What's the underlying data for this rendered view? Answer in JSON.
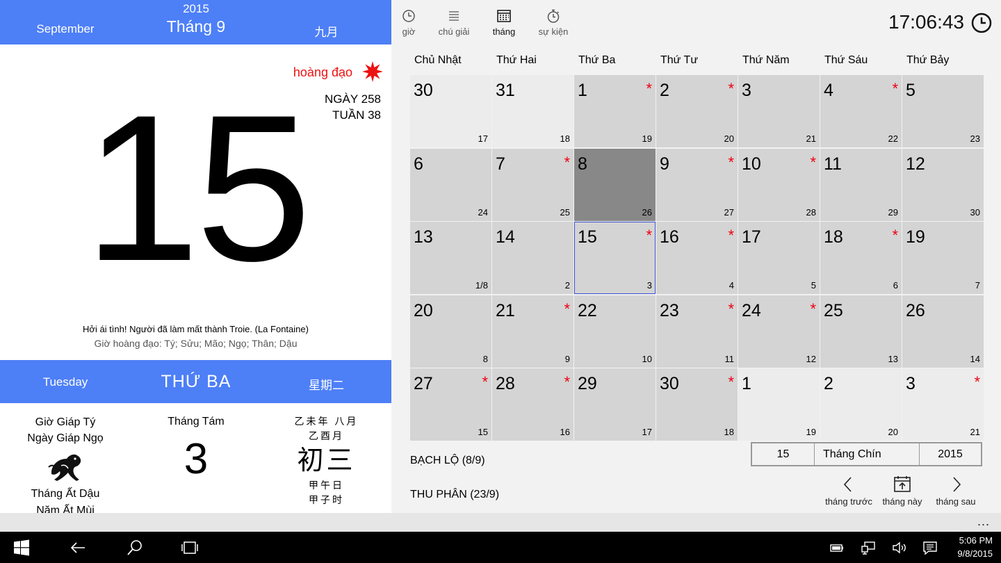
{
  "header": {
    "english_month": "September",
    "year": "2015",
    "vietnamese_month": "Tháng 9",
    "chinese_month": "九月"
  },
  "day_info": {
    "auspicious_label": "hoàng đạo",
    "day_of_year": "NGÀY 258",
    "week_of_year": "TUẦN 38",
    "day": "15",
    "quote": "Hởi ái tình! Người đã làm mất thành Troie. (La Fontaine)",
    "good_hours": "Giờ hoàng đạo: Tý; Sửu; Mão; Ngọ; Thân; Dậu"
  },
  "weekday": {
    "english": "Tuesday",
    "vietnamese": "THỨ BA",
    "chinese": "星期二"
  },
  "lunar": {
    "hour": "Giờ Giáp Tý",
    "day_name": "Ngày Giáp Ngọ",
    "month_name": "Tháng Ất Dậu",
    "year_name": "Năm Ất Mùi",
    "month_label": "Tháng Tám",
    "lunar_day": "3",
    "cn_line1": "乙未年 八月",
    "cn_line2": "乙酉月",
    "cn_big": "初三",
    "cn_line3": "甲午日",
    "cn_line4": "甲子时"
  },
  "toolbar": {
    "items": [
      {
        "label": "giờ",
        "icon": "clock-icon"
      },
      {
        "label": "chú giải",
        "icon": "list-icon"
      },
      {
        "label": "tháng",
        "icon": "calendar-icon"
      },
      {
        "label": "sự kiện",
        "icon": "stopwatch-icon"
      }
    ],
    "active": "tháng",
    "clock": "17:06:43"
  },
  "calendar": {
    "weekdays": [
      "Chủ Nhật",
      "Thứ Hai",
      "Thứ Ba",
      "Thứ Tư",
      "Thứ Năm",
      "Thứ Sáu",
      "Thứ Bảy"
    ],
    "weeks": [
      [
        {
          "d": "30",
          "l": "17",
          "other": true,
          "star": false
        },
        {
          "d": "31",
          "l": "18",
          "other": true,
          "star": false
        },
        {
          "d": "1",
          "l": "19",
          "star": true
        },
        {
          "d": "2",
          "l": "20",
          "star": true
        },
        {
          "d": "3",
          "l": "21",
          "star": false
        },
        {
          "d": "4",
          "l": "22",
          "star": true
        },
        {
          "d": "5",
          "l": "23",
          "star": false
        }
      ],
      [
        {
          "d": "6",
          "l": "24",
          "star": false
        },
        {
          "d": "7",
          "l": "25",
          "star": true
        },
        {
          "d": "8",
          "l": "26",
          "star": false,
          "today": true
        },
        {
          "d": "9",
          "l": "27",
          "star": true
        },
        {
          "d": "10",
          "l": "28",
          "star": true
        },
        {
          "d": "11",
          "l": "29",
          "star": false
        },
        {
          "d": "12",
          "l": "30",
          "star": false
        }
      ],
      [
        {
          "d": "13",
          "l": "1/8",
          "star": false
        },
        {
          "d": "14",
          "l": "2",
          "star": false
        },
        {
          "d": "15",
          "l": "3",
          "star": true,
          "selected": true
        },
        {
          "d": "16",
          "l": "4",
          "star": true
        },
        {
          "d": "17",
          "l": "5",
          "star": false
        },
        {
          "d": "18",
          "l": "6",
          "star": true
        },
        {
          "d": "19",
          "l": "7",
          "star": false
        }
      ],
      [
        {
          "d": "20",
          "l": "8",
          "star": false
        },
        {
          "d": "21",
          "l": "9",
          "star": true
        },
        {
          "d": "22",
          "l": "10",
          "star": false
        },
        {
          "d": "23",
          "l": "11",
          "star": true
        },
        {
          "d": "24",
          "l": "12",
          "star": true
        },
        {
          "d": "25",
          "l": "13",
          "star": false
        },
        {
          "d": "26",
          "l": "14",
          "star": false
        }
      ],
      [
        {
          "d": "27",
          "l": "15",
          "star": true
        },
        {
          "d": "28",
          "l": "16",
          "star": true
        },
        {
          "d": "29",
          "l": "17",
          "star": false
        },
        {
          "d": "30",
          "l": "18",
          "star": true
        },
        {
          "d": "1",
          "l": "19",
          "other": true,
          "star": false
        },
        {
          "d": "2",
          "l": "20",
          "other": true,
          "star": false
        },
        {
          "d": "3",
          "l": "21",
          "other": true,
          "star": true
        }
      ]
    ],
    "star_symbol": "*"
  },
  "solar_terms": [
    "BẠCH LỘ (8/9)",
    "THU PHÂN (23/9)"
  ],
  "date_picker": {
    "day": "15",
    "month": "Tháng Chín",
    "year": "2015"
  },
  "nav": {
    "prev": "tháng trước",
    "this": "tháng này",
    "next": "tháng sau"
  },
  "appbar": {
    "more": "..."
  },
  "taskbar": {
    "time": "5:06 PM",
    "date": "9/8/2015"
  },
  "colors": {
    "accent": "#4d7ff7",
    "star": "#e01111",
    "today_cell": "#888888",
    "selected_border": "#3b4fd1"
  }
}
